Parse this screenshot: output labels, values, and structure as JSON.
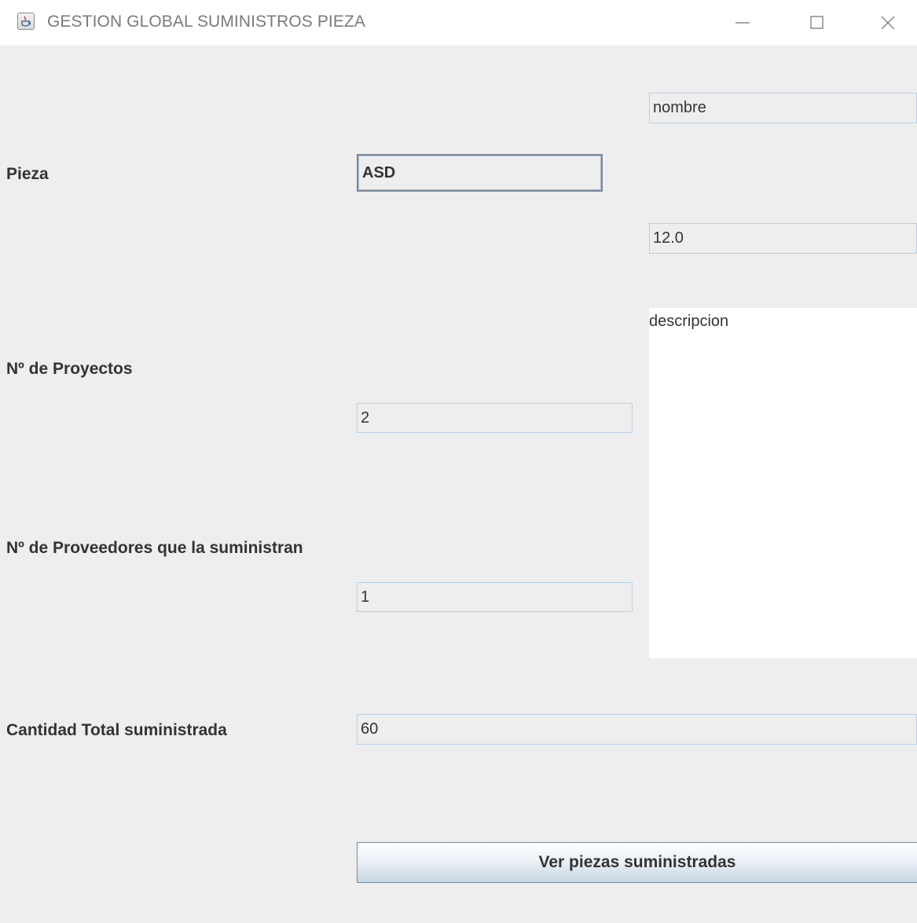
{
  "window": {
    "title": "GESTION GLOBAL SUMINISTROS PIEZA",
    "app_icon": "java-coffee-cup-icon",
    "controls": [
      "minimize-icon",
      "maximize-icon",
      "close-icon"
    ]
  },
  "form": {
    "pieza": {
      "label": "Pieza",
      "value": "ASD"
    },
    "nombre": {
      "value": "nombre"
    },
    "precio": {
      "value": "12.0"
    },
    "descripcion": {
      "value": "descripcion"
    },
    "num_proyectos": {
      "label": "Nº de Proyectos",
      "value": "2"
    },
    "num_proveedores": {
      "label": "Nº de Proveedores que la suministran",
      "value": "1"
    },
    "cantidad_total": {
      "label": "Cantidad Total suministrada",
      "value": "60"
    }
  },
  "actions": {
    "ver_piezas_label": "Ver piezas suministradas"
  },
  "colors": {
    "background": "#eeeeee",
    "field_border": "#b8cfe5",
    "text": "#333333"
  }
}
